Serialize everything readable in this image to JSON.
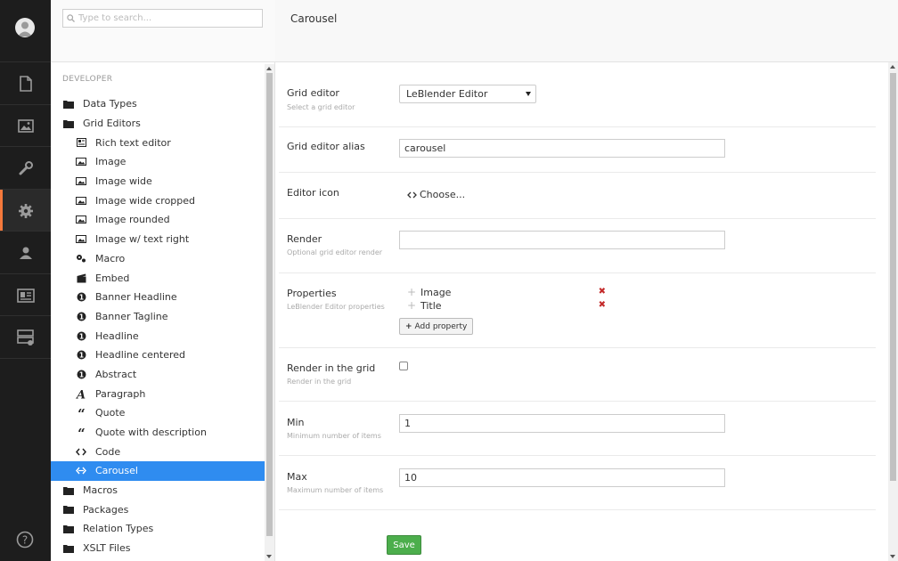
{
  "search": {
    "placeholder": "Type to search..."
  },
  "tree": {
    "section_title": "DEVELOPER",
    "items": [
      {
        "label": "Data Types",
        "level": 0,
        "icon": "folder-icon"
      },
      {
        "label": "Grid Editors",
        "level": 0,
        "icon": "folder-icon"
      },
      {
        "label": "Rich text editor",
        "level": 1,
        "icon": "rte-icon"
      },
      {
        "label": "Image",
        "level": 1,
        "icon": "picture-icon"
      },
      {
        "label": "Image wide",
        "level": 1,
        "icon": "picture-icon"
      },
      {
        "label": "Image wide cropped",
        "level": 1,
        "icon": "picture-icon"
      },
      {
        "label": "Image rounded",
        "level": 1,
        "icon": "picture-icon"
      },
      {
        "label": "Image w/ text right",
        "level": 1,
        "icon": "picture-icon"
      },
      {
        "label": "Macro",
        "level": 1,
        "icon": "settings-alt-icon"
      },
      {
        "label": "Embed",
        "level": 1,
        "icon": "movie-alt-icon"
      },
      {
        "label": "Banner Headline",
        "level": 1,
        "icon": "info-circle-icon"
      },
      {
        "label": "Banner Tagline",
        "level": 1,
        "icon": "info-circle-icon"
      },
      {
        "label": "Headline",
        "level": 1,
        "icon": "info-circle-icon"
      },
      {
        "label": "Headline centered",
        "level": 1,
        "icon": "info-circle-icon"
      },
      {
        "label": "Abstract",
        "level": 1,
        "icon": "info-circle-icon"
      },
      {
        "label": "Paragraph",
        "level": 1,
        "icon": "font-icon"
      },
      {
        "label": "Quote",
        "level": 1,
        "icon": "quote-icon"
      },
      {
        "label": "Quote with description",
        "level": 1,
        "icon": "quote-icon"
      },
      {
        "label": "Code",
        "level": 1,
        "icon": "code-icon"
      },
      {
        "label": "Carousel",
        "level": 1,
        "icon": "carousel-icon",
        "selected": true
      },
      {
        "label": "Macros",
        "level": 0,
        "icon": "folder-icon"
      },
      {
        "label": "Packages",
        "level": 0,
        "icon": "folder-icon"
      },
      {
        "label": "Relation Types",
        "level": 0,
        "icon": "folder-icon"
      },
      {
        "label": "XSLT Files",
        "level": 0,
        "icon": "folder-icon"
      }
    ]
  },
  "header": {
    "title": "Carousel"
  },
  "form": {
    "grid_editor": {
      "label": "Grid editor",
      "desc": "Select a grid editor",
      "value": "LeBlender Editor"
    },
    "alias": {
      "label": "Grid editor alias",
      "value": "carousel"
    },
    "icon": {
      "label": "Editor icon",
      "choose": "Choose..."
    },
    "render": {
      "label": "Render",
      "desc": "Optional grid editor render",
      "value": ""
    },
    "properties": {
      "label": "Properties",
      "desc": "LeBlender Editor properties",
      "items": [
        "Image",
        "Title"
      ],
      "add_label": "Add property"
    },
    "render_in_grid": {
      "label": "Render in the grid",
      "desc": "Render in the grid",
      "checked": false
    },
    "min": {
      "label": "Min",
      "desc": "Minimum number of items",
      "value": "1"
    },
    "max": {
      "label": "Max",
      "desc": "Maximum number of items",
      "value": "10"
    }
  },
  "save_label": "Save",
  "colors": {
    "selected": "#2f8cf0",
    "accent": "#f5793b",
    "save": "#4cae4c",
    "nav_bg": "#1d1d1d"
  }
}
